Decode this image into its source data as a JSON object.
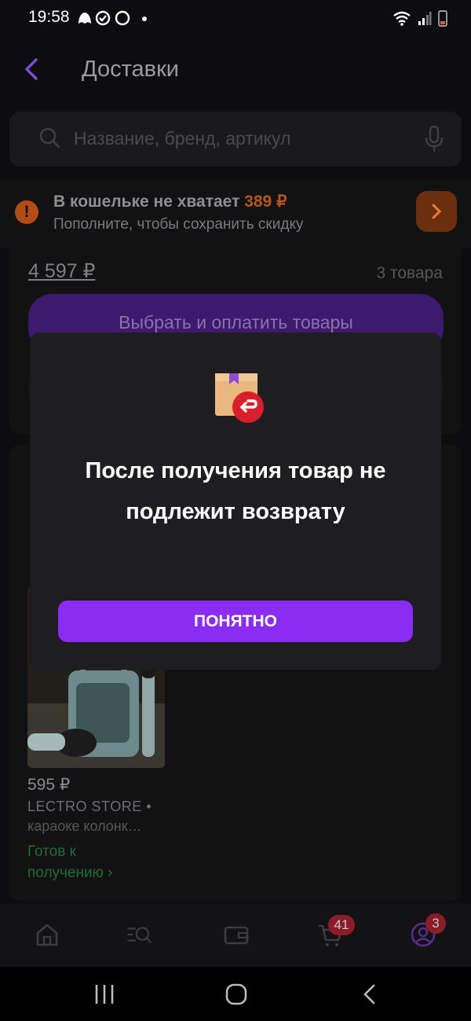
{
  "status_bar": {
    "time": "19:58",
    "notification_icons": [
      "snapchat-icon",
      "check-circle-icon",
      "whatsapp-icon",
      "dot-icon"
    ]
  },
  "header": {
    "title": "Доставки"
  },
  "search": {
    "placeholder": "Название, бренд, артикул"
  },
  "wallet_banner": {
    "title_prefix": "В кошельке не хватает",
    "amount": "389 ₽",
    "subtitle": "Пополните, чтобы сохранить скидку"
  },
  "order_card": {
    "price": "4 597 ₽",
    "count": "3 товара",
    "pay_button": "Выбрать и оплатить товары"
  },
  "product": {
    "price": "595 ₽",
    "store": "LECTRO STORE •",
    "name": "караоке колонк…",
    "status": "Готов к получению ›"
  },
  "bottom_nav": {
    "items": [
      "home-icon",
      "catalog-search-icon",
      "wallet-icon",
      "cart-icon",
      "profile-icon"
    ],
    "cart_badge": "41",
    "profile_badge": "3"
  },
  "modal": {
    "headline": "После получения товар не подлежит возврату",
    "ok_button": "ПОНЯТНО",
    "illustration": "box-return-icon"
  },
  "colors": {
    "accent": "#8b2cf2",
    "warning": "#b45720",
    "success": "#1f6b3a"
  }
}
